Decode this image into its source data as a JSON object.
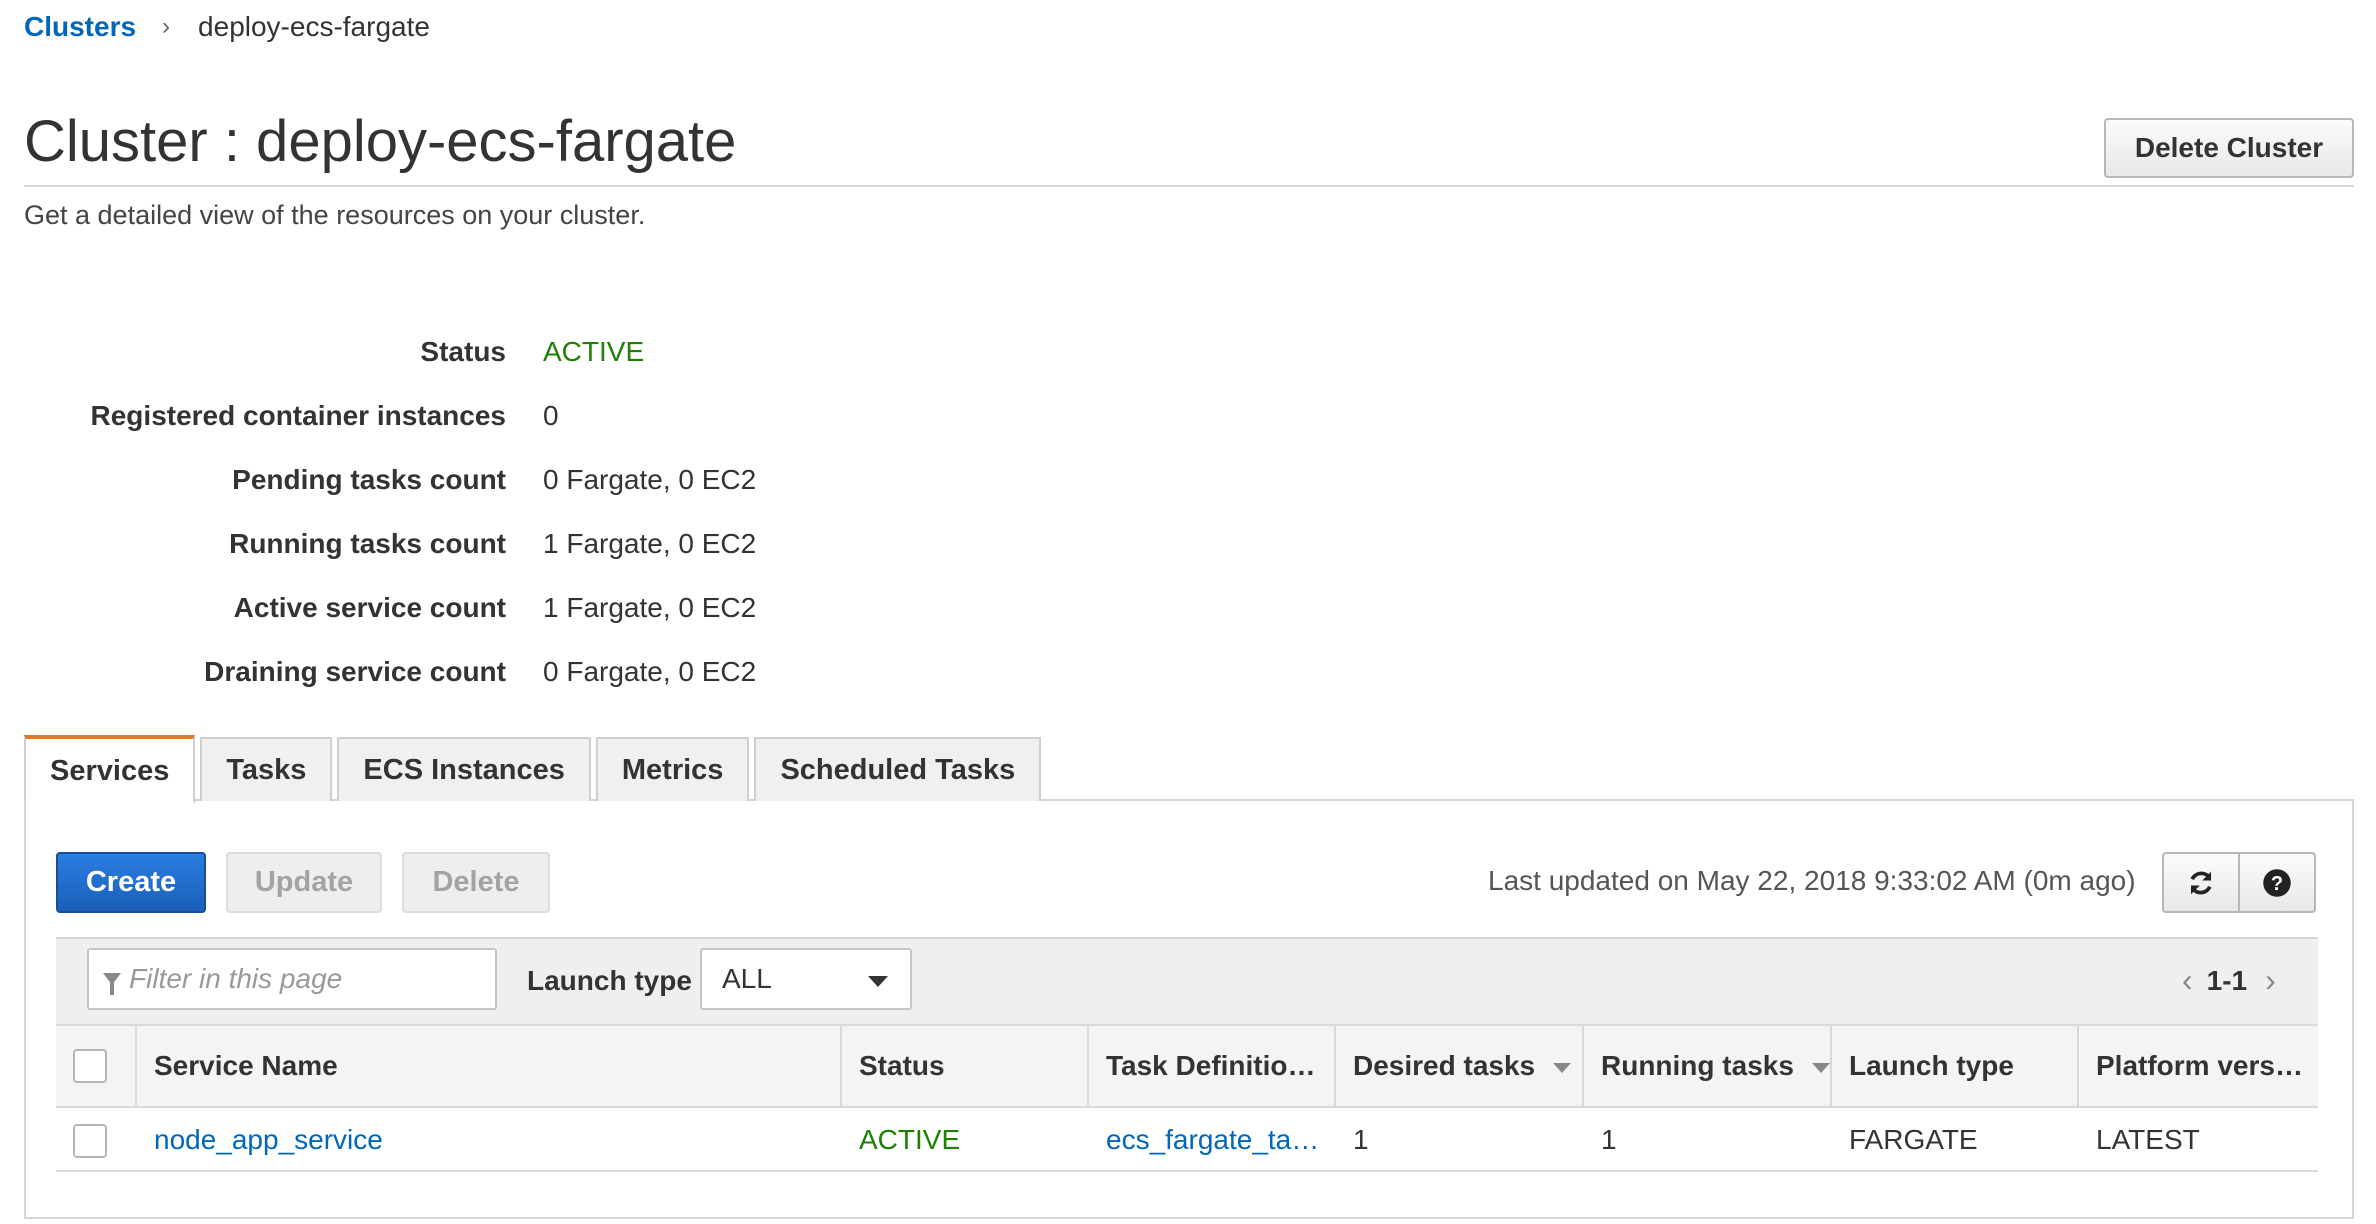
{
  "breadcrumb": {
    "parent": "Clusters",
    "separator": "›",
    "current": "deploy-ecs-fargate"
  },
  "page": {
    "title": "Cluster : deploy-ecs-fargate",
    "subtitle": "Get a detailed view of the resources on your cluster.",
    "delete_button": "Delete Cluster"
  },
  "details": [
    {
      "label": "Status",
      "value": "ACTIVE"
    },
    {
      "label": "Registered container instances",
      "value": "0"
    },
    {
      "label": "Pending tasks count",
      "value": "0 Fargate, 0 EC2"
    },
    {
      "label": "Running tasks count",
      "value": "1 Fargate, 0 EC2"
    },
    {
      "label": "Active service count",
      "value": "1 Fargate, 0 EC2"
    },
    {
      "label": "Draining service count",
      "value": "0 Fargate, 0 EC2"
    }
  ],
  "tabs": [
    "Services",
    "Tasks",
    "ECS Instances",
    "Metrics",
    "Scheduled Tasks"
  ],
  "selected_tab": "Services",
  "toolbar": {
    "create": "Create",
    "update": "Update",
    "delete": "Delete",
    "last_updated": "Last updated on May 22, 2018 9:33:02 AM (0m ago)",
    "refresh_icon": "refresh-icon",
    "help_icon": "help-icon",
    "help_glyph": "?"
  },
  "filter": {
    "placeholder": "Filter in this page",
    "launch_type_label": "Launch type",
    "launch_type_value": "ALL",
    "page_range": "1-1",
    "prev": "‹",
    "next": "›"
  },
  "table": {
    "headers": [
      "Service Name",
      "Status",
      "Task Definitio…",
      "Desired tasks",
      "Running tasks",
      "Launch type",
      "Platform vers…"
    ],
    "rows": [
      [
        "node_app_service",
        "ACTIVE",
        "ecs_fargate_ta…",
        "1",
        "1",
        "FARGATE",
        "LATEST"
      ]
    ]
  },
  "colors": {
    "link": "#0066bb",
    "active": "#1d8102",
    "primary": "#1a5fb8",
    "tab_accent": "#e07b24"
  }
}
